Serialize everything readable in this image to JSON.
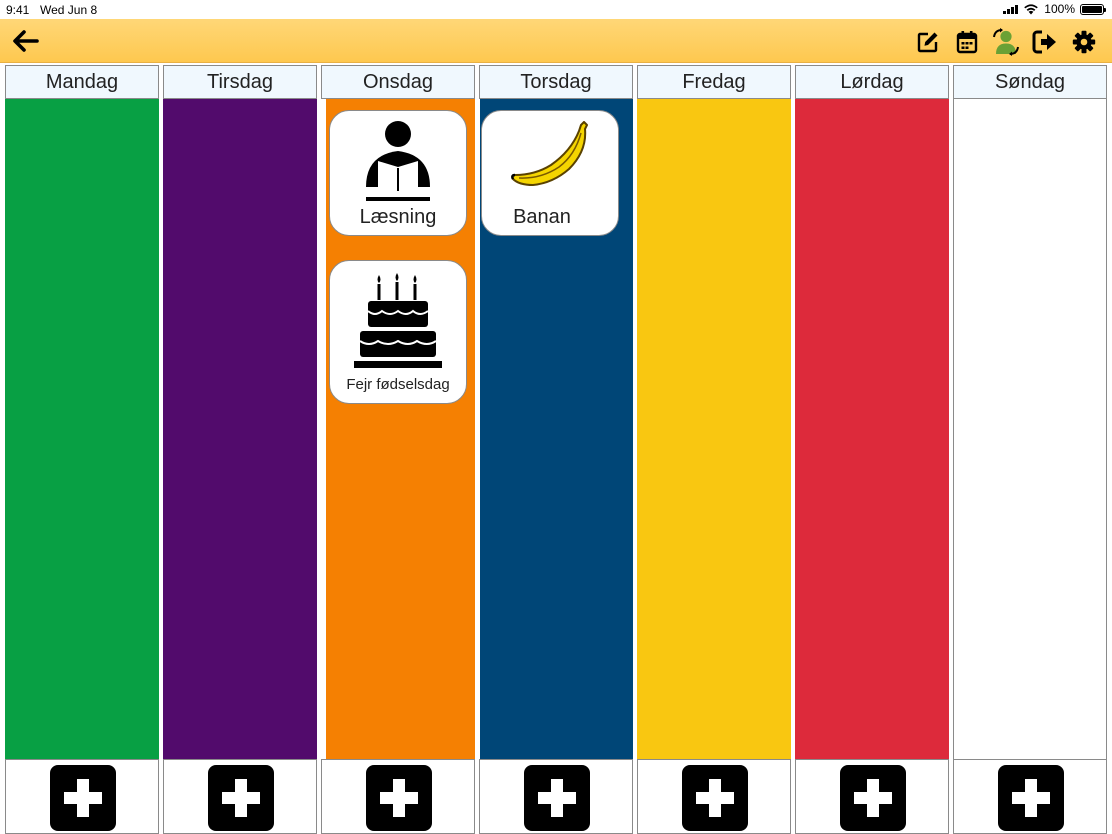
{
  "status_bar": {
    "time": "9:41",
    "date": "Wed Jun 8",
    "battery": "100%",
    "battery_level": 1.0
  },
  "toolbar": {
    "background": "#fecb57",
    "back_icon": "arrow-left-icon",
    "tools": [
      {
        "icon": "edit-icon"
      },
      {
        "icon": "calendar-icon"
      },
      {
        "icon": "switch-user-icon"
      },
      {
        "icon": "logout-icon"
      },
      {
        "icon": "gear-icon"
      }
    ]
  },
  "week": [
    {
      "name": "Mandag",
      "color": "#08a044",
      "activities": []
    },
    {
      "name": "Tirsdag",
      "color": "#520b6c",
      "activities": []
    },
    {
      "name": "Onsdag",
      "color": "#f58002",
      "activities": [
        {
          "label": "Læsning",
          "icon": "reading-person-icon"
        },
        {
          "label": "Fejr fødselsdag",
          "icon": "birthday-cake-icon"
        }
      ]
    },
    {
      "name": "Torsdag",
      "color": "#004677",
      "activities": [
        {
          "label": "Banan",
          "icon": "banana-icon"
        }
      ]
    },
    {
      "name": "Fredag",
      "color": "#f9c711",
      "activities": []
    },
    {
      "name": "Lørdag",
      "color": "#dd2a3b",
      "activities": []
    },
    {
      "name": "Søndag",
      "color": "#ffffff",
      "activities": []
    }
  ],
  "add_icon": "plus-icon"
}
